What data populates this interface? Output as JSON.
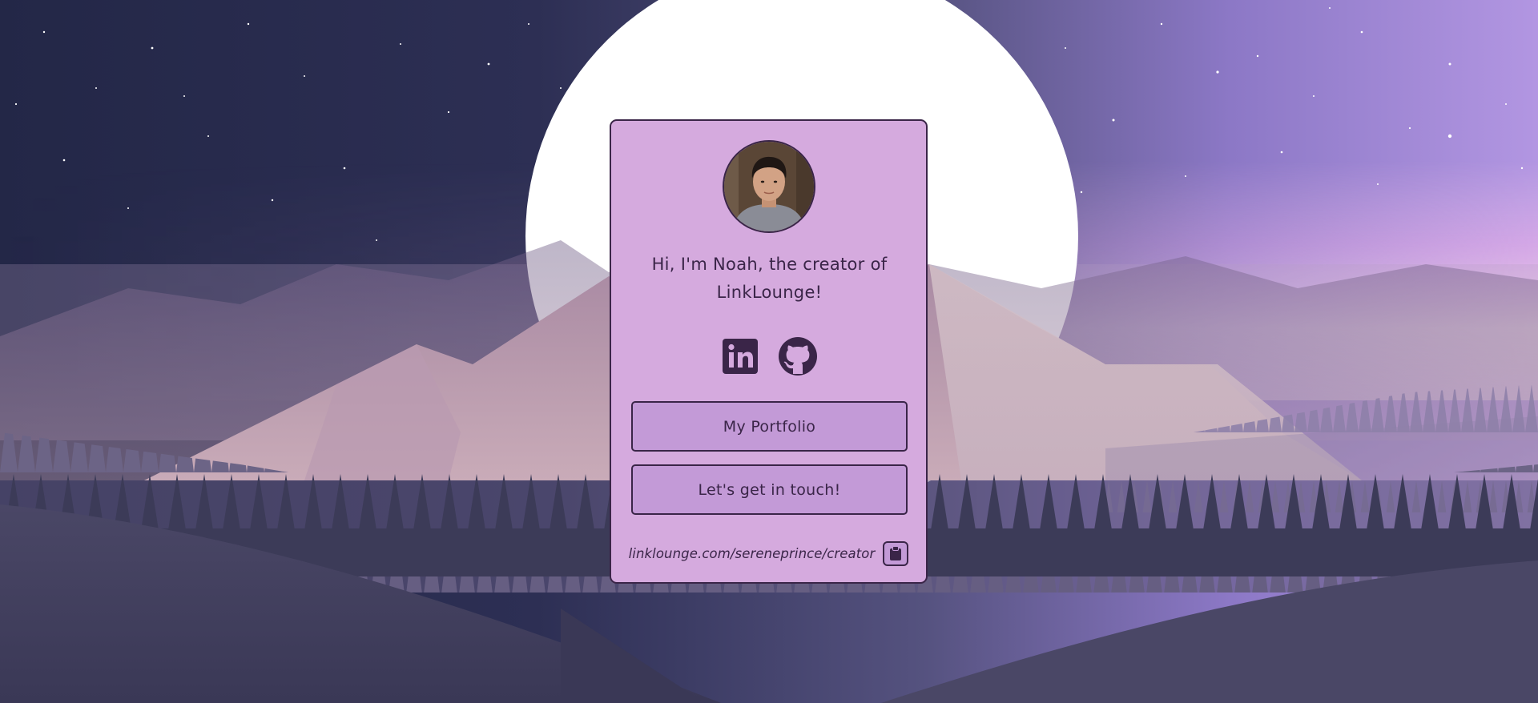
{
  "profile": {
    "greeting": "Hi, I'm Noah, the creator of LinkLounge!",
    "avatar_icon": "profile-photo"
  },
  "socials": [
    {
      "name": "LinkedIn",
      "icon": "linkedin-icon"
    },
    {
      "name": "GitHub",
      "icon": "github-icon"
    }
  ],
  "links": {
    "portfolio_label": "My Portfolio",
    "contact_label": "Let's get in touch!"
  },
  "share": {
    "url": "linklounge.com/sereneprince/creator",
    "copy_icon": "clipboard-icon"
  },
  "colors": {
    "card_bg": "#d5aade",
    "button_bg": "#c39ad7",
    "text": "#3a2548",
    "sky_dark": "#262a4a",
    "sky_light": "#ad92dd",
    "horizon_pink": "#e9b4e5",
    "moon": "#ffffff"
  }
}
